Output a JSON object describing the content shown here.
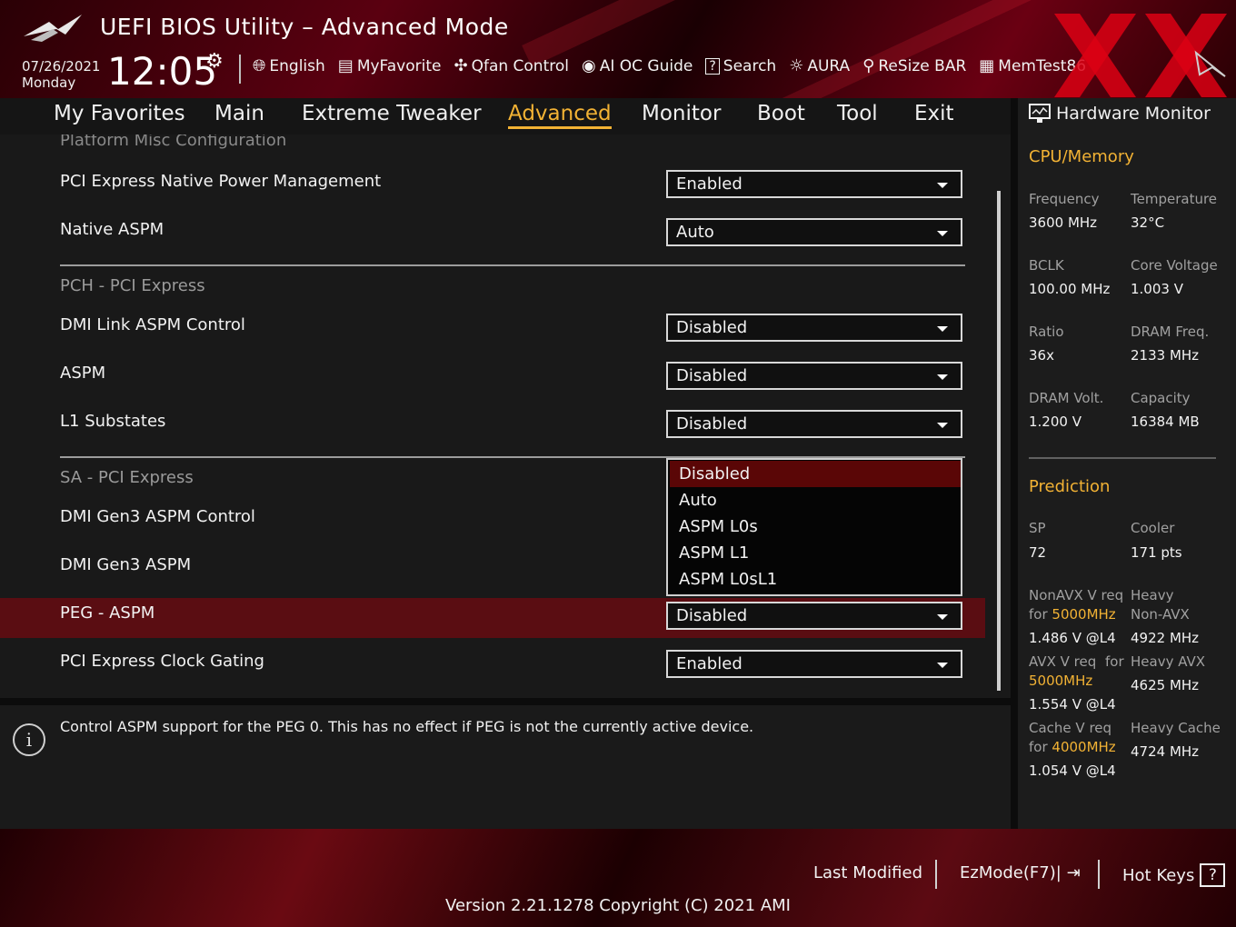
{
  "header": {
    "title": "UEFI BIOS Utility – Advanced Mode",
    "date": "07/26/2021",
    "day": "Monday",
    "time": "12:05",
    "toolbar": [
      {
        "label": "English",
        "icon": "globe-icon"
      },
      {
        "label": "MyFavorite",
        "icon": "favorite-icon"
      },
      {
        "label": "Qfan Control",
        "icon": "fan-icon"
      },
      {
        "label": "AI OC Guide",
        "icon": "ai-icon"
      },
      {
        "label": "Search",
        "icon": "search-icon"
      },
      {
        "label": "AURA",
        "icon": "aura-icon"
      },
      {
        "label": "ReSize BAR",
        "icon": "resize-bar-icon"
      },
      {
        "label": "MemTest86",
        "icon": "memtest-icon"
      }
    ]
  },
  "tabs": [
    "My Favorites",
    "Main",
    "Extreme Tweaker",
    "Advanced",
    "Monitor",
    "Boot",
    "Tool",
    "Exit"
  ],
  "active_tab": "Advanced",
  "main": {
    "cut_heading": "Platform Misc Configuration",
    "rows": [
      {
        "label": "PCI Express Native Power Management",
        "value": "Enabled"
      },
      {
        "label": "Native ASPM",
        "value": "Auto"
      },
      {
        "label": "DMI Link ASPM Control",
        "value": "Disabled"
      },
      {
        "label": "ASPM",
        "value": "Disabled"
      },
      {
        "label": "L1 Substates",
        "value": "Disabled"
      },
      {
        "label": "DMI Gen3 ASPM Control",
        "value": ""
      },
      {
        "label": "DMI Gen3 ASPM",
        "value": ""
      },
      {
        "label": "PEG - ASPM",
        "value": "Disabled"
      },
      {
        "label": "PCI Express Clock Gating",
        "value": "Enabled"
      }
    ],
    "sections": [
      "PCH - PCI Express",
      "SA - PCI Express"
    ],
    "dropdown_options": [
      "Disabled",
      "Auto",
      "ASPM L0s",
      "ASPM L1",
      "ASPM L0sL1"
    ],
    "dropdown_selected": "Disabled"
  },
  "info": {
    "text": "Control ASPM support for the PEG 0.  This has no effect if PEG is not the currently active device."
  },
  "hw": {
    "title": "Hardware Monitor",
    "cpu_section": "CPU/Memory",
    "cpu": [
      {
        "k": "Frequency",
        "v": "3600 MHz"
      },
      {
        "k": "Temperature",
        "v": "32°C"
      },
      {
        "k": "BCLK",
        "v": "100.00 MHz"
      },
      {
        "k": "Core Voltage",
        "v": "1.003 V"
      },
      {
        "k": "Ratio",
        "v": "36x"
      },
      {
        "k": "DRAM Freq.",
        "v": "2133 MHz"
      },
      {
        "k": "DRAM Volt.",
        "v": "1.200 V"
      },
      {
        "k": "Capacity",
        "v": "16384 MB"
      }
    ],
    "pred_section": "Prediction",
    "sp_k": "SP",
    "sp_v": "72",
    "cooler_k": "Cooler",
    "cooler_v": "171 pts",
    "nonavx_k1": "NonAVX V req",
    "nonavx_k2a": "for ",
    "nonavx_k2b": "5000MHz",
    "nonavx_v": "1.486 V @L4",
    "heavy_nonavx_k1": "Heavy",
    "heavy_nonavx_k2": "Non-AVX",
    "heavy_nonavx_v": "4922 MHz",
    "avx_k1": "AVX V req",
    "avx_for": "for",
    "avx_k2": "5000MHz",
    "avx_v": "1.554 V @L4",
    "heavy_avx_k": "Heavy AVX",
    "heavy_avx_v": "4625 MHz",
    "cache_k1": "Cache V req",
    "cache_k2a": "for ",
    "cache_k2b": "4000MHz",
    "cache_v": "1.054 V @L4",
    "heavy_cache_k": "Heavy Cache",
    "heavy_cache_v": "4724 MHz"
  },
  "footer": {
    "last_modified": "Last Modified",
    "ezmode": "EzMode(F7)|",
    "hotkeys": "Hot Keys",
    "hotkeys_glyph": "?",
    "version": "Version 2.21.1278 Copyright (C) 2021 AMI"
  },
  "colors": {
    "accent": "#f2b234",
    "highlight": "#5a0d12",
    "selected_option": "#5a0606"
  }
}
